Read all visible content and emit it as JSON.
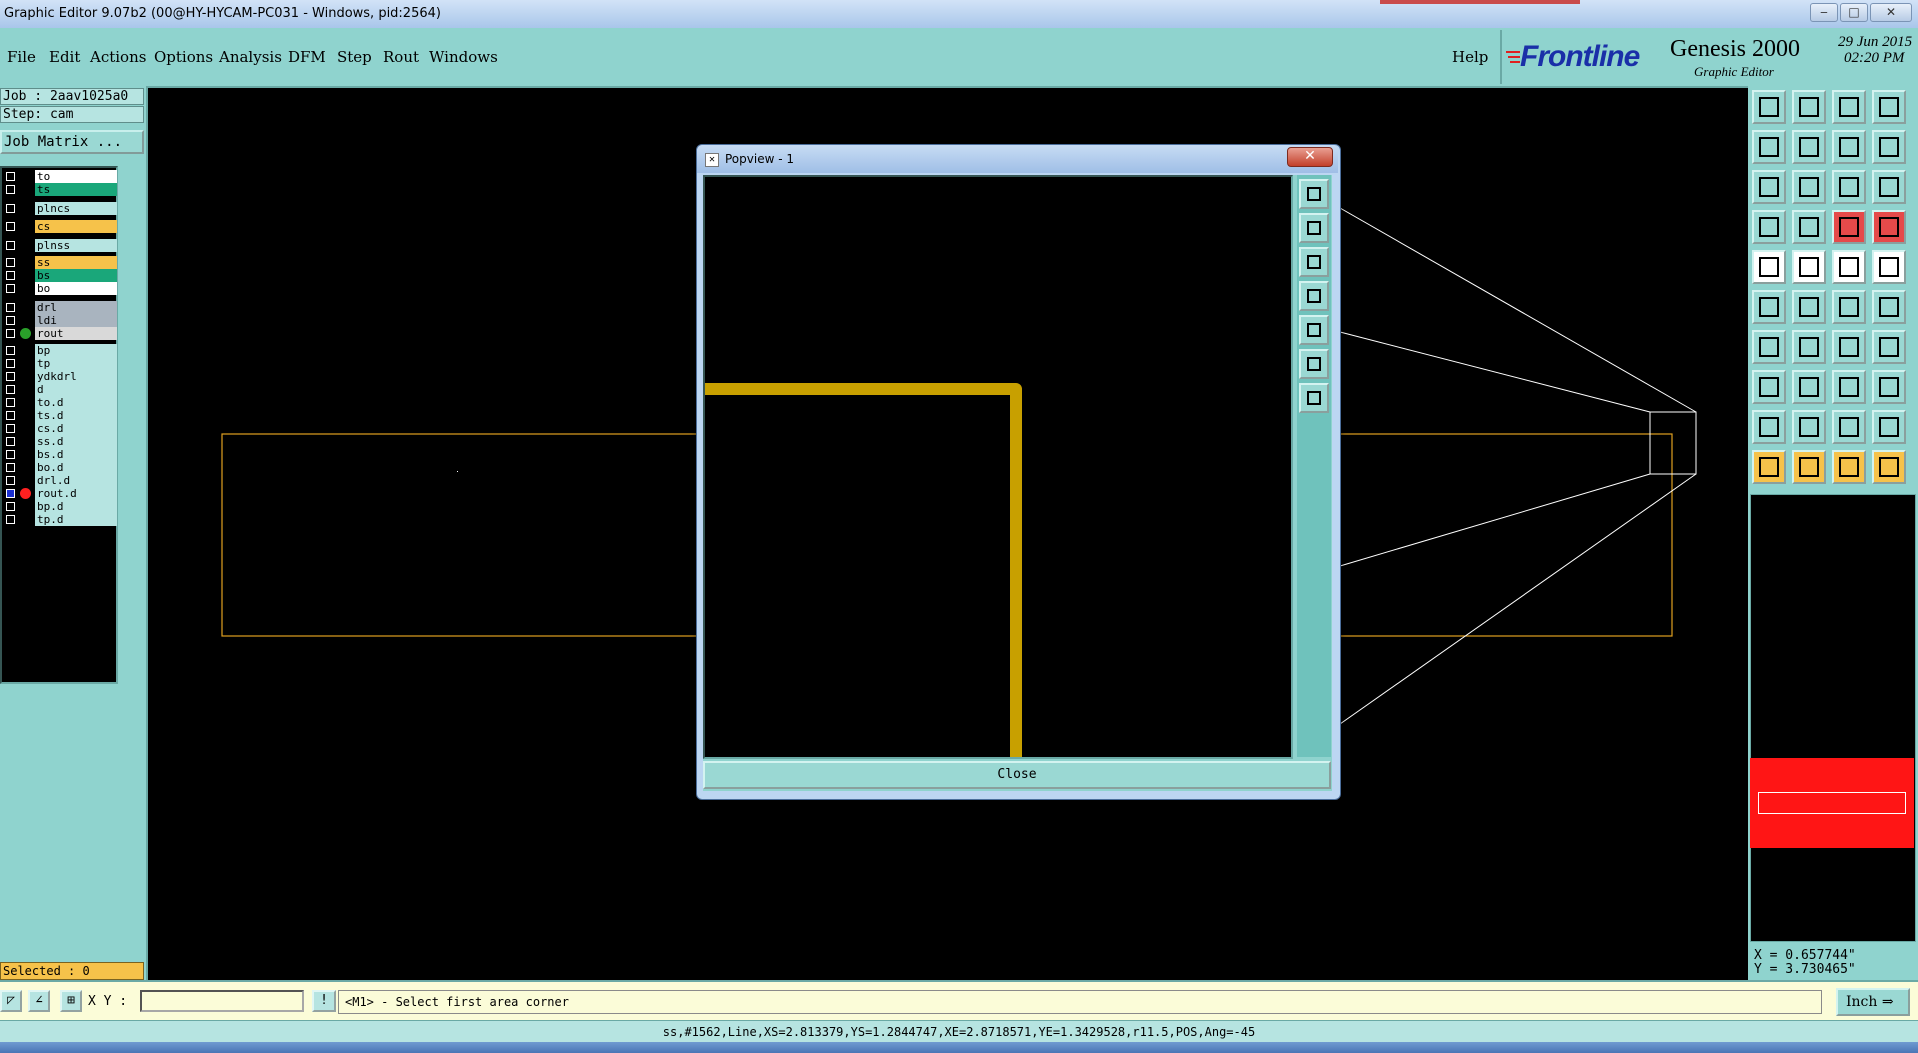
{
  "window": {
    "title": "Graphic Editor 9.07b2 (00@HY-HYCAM-PC031 - Windows, pid:2564)",
    "min": "‒",
    "max": "□",
    "close": "✕"
  },
  "menu": [
    "File",
    "Edit",
    "Actions",
    "Options",
    "Analysis",
    "DFM",
    "Step",
    "Rout",
    "Windows"
  ],
  "help": "Help",
  "brand": {
    "name": "Frontline",
    "product": "Genesis 2000",
    "subtitle": "Graphic Editor",
    "date": "29 Jun 2015",
    "time": "02:20 PM"
  },
  "job": "Job : 2aav1025a0",
  "step": "Step: cam",
  "job_matrix": "Job Matrix ...",
  "layers": [
    {
      "name": "to",
      "color": "#ffffff"
    },
    {
      "name": "ts",
      "color": "#1aa77a"
    },
    {
      "name": "plncs",
      "color": "#b6e4e1"
    },
    {
      "name": "cs",
      "color": "#f6c24a"
    },
    {
      "name": "plnss",
      "color": "#b6e4e1"
    },
    {
      "name": "ss",
      "color": "#f6c24a"
    },
    {
      "name": "bs",
      "color": "#1aa77a"
    },
    {
      "name": "bo",
      "color": "#ffffff"
    },
    {
      "name": "drl",
      "color": "#a9b4bf"
    },
    {
      "name": "ldi",
      "color": "#a9b4bf"
    },
    {
      "name": "rout",
      "color": "#d9d9d9",
      "dot": "#2aa02a"
    },
    {
      "name": "bp",
      "color": "#b6e4e1"
    },
    {
      "name": "tp",
      "color": "#b6e4e1"
    },
    {
      "name": "ydkdrl",
      "color": "#b6e4e1"
    },
    {
      "name": "d",
      "color": "#b6e4e1"
    },
    {
      "name": "to.d",
      "color": "#b6e4e1"
    },
    {
      "name": "ts.d",
      "color": "#b6e4e1"
    },
    {
      "name": "cs.d",
      "color": "#b6e4e1"
    },
    {
      "name": "ss.d",
      "color": "#b6e4e1"
    },
    {
      "name": "bs.d",
      "color": "#b6e4e1"
    },
    {
      "name": "bo.d",
      "color": "#b6e4e1"
    },
    {
      "name": "drl.d",
      "color": "#b6e4e1"
    },
    {
      "name": "rout.d",
      "color": "#b6e4e1",
      "dot": "#ff2020",
      "checked": true
    },
    {
      "name": "bp.d",
      "color": "#b6e4e1"
    },
    {
      "name": "tp.d",
      "color": "#b6e4e1"
    }
  ],
  "selected": "Selected : 0",
  "coords": {
    "x": "X = 0.657744\"",
    "y": "Y = 3.730465\""
  },
  "popview": {
    "title": "Popview - 1",
    "close_button": "Close",
    "close_x": "✕",
    "icon": "✕"
  },
  "xy_label": "X Y :",
  "xy_value": "",
  "prompt": "<M1> - Select first area corner",
  "prompt_button": "!",
  "unit": "Inch ⇒",
  "status": "ss,#1562,Line,XS=2.813379,YS=1.2844747,XE=2.8718571,YE=1.3429528,r11.5,POS,Ang=-45",
  "colors": {
    "teal": "#8fd3ce",
    "trace": "#c8a000",
    "outline": "#e0a020"
  }
}
